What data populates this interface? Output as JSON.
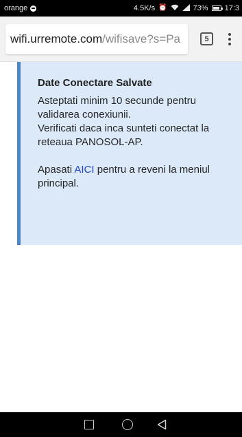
{
  "status_bar": {
    "carrier": "orange",
    "right_text": "4.5K/s",
    "battery": "73%",
    "time": "17:3"
  },
  "browser": {
    "url_host": "wifi.urremote.com",
    "url_path": "/wifisave?s=Pa",
    "tab_count": "5"
  },
  "message": {
    "title": "Date Conectare Salvate",
    "line1": "Asteptati minim 10 secunde pentru validarea conexiunii.",
    "line2": "Verificati daca inca sunteti conectat la reteaua PANOSOL-AP.",
    "line3_prefix": "Apasati ",
    "link_text": "AICI",
    "line3_suffix": " pentru a reveni la meniul principal."
  },
  "colors": {
    "panel_bg": "#dbe9f9",
    "panel_border": "#4a86c8",
    "link": "#2148c4"
  },
  "icons": {
    "nav": [
      "recent-apps-icon",
      "home-icon",
      "back-icon"
    ]
  }
}
